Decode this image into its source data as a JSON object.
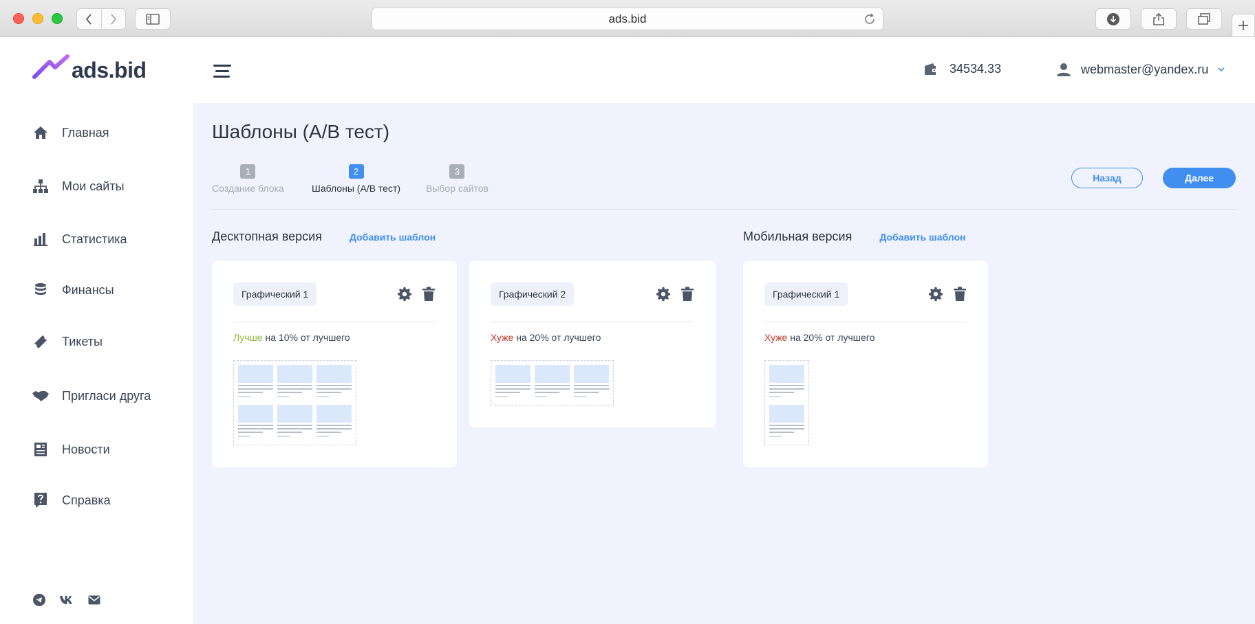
{
  "browser": {
    "url": "ads.bid"
  },
  "app": {
    "logo_text": "ads.bid",
    "balance": "34534.33",
    "user_email": "webmaster@yandex.ru"
  },
  "sidebar": {
    "items": [
      {
        "label": "Главная",
        "icon": "home-icon"
      },
      {
        "label": "Мои сайты",
        "icon": "sitemap-icon"
      },
      {
        "label": "Статистика",
        "icon": "bar-chart-icon"
      },
      {
        "label": "Финансы",
        "icon": "coins-icon"
      },
      {
        "label": "Тикеты",
        "icon": "ticket-icon"
      },
      {
        "label": "Пригласи друга",
        "icon": "handshake-icon"
      },
      {
        "label": "Новости",
        "icon": "newspaper-icon"
      },
      {
        "label": "Справка",
        "icon": "question-icon"
      }
    ],
    "socials": [
      "telegram-icon",
      "vk-icon",
      "mail-icon"
    ]
  },
  "page": {
    "title": "Шаблоны (А/В тест)",
    "steps": [
      {
        "num": "1",
        "label": "Создание блока"
      },
      {
        "num": "2",
        "label": "Шаблоны (А/В тест)"
      },
      {
        "num": "3",
        "label": "Выбор сайтов"
      }
    ],
    "active_step": 2,
    "back_label": "Назад",
    "next_label": "Далее"
  },
  "desktop": {
    "title": "Десктопная версия",
    "add_label": "Добавить шаблон",
    "cards": [
      {
        "name": "Графический 1",
        "verdict": "Лучше",
        "rest": " на 10% от лучшего",
        "tone": "good"
      },
      {
        "name": "Графический 2",
        "verdict": "Хуже",
        "rest": " на 20% от лучшего",
        "tone": "bad"
      }
    ]
  },
  "mobile": {
    "title": "Мобильная версия",
    "add_label": "Добавить шаблон",
    "cards": [
      {
        "name": "Графический 1",
        "verdict": "Хуже",
        "rest": " на 20% от лучшего",
        "tone": "bad"
      }
    ]
  },
  "colors": {
    "accent": "#3f8ef0",
    "good": "#8bbd3a",
    "bad": "#c0392b",
    "main_bg": "#f0f3fd"
  }
}
